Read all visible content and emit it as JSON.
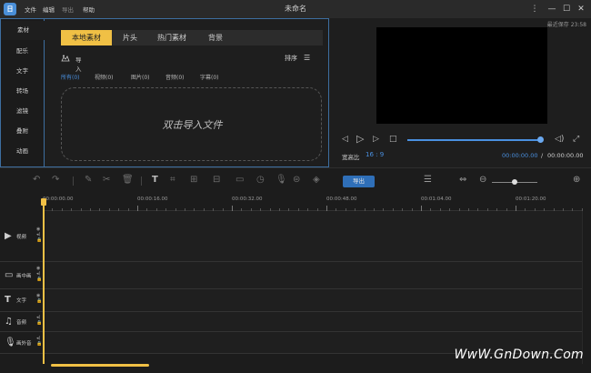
{
  "titlebar": {
    "logo": "日",
    "menu": [
      "文件",
      "编辑",
      "导出",
      "帮助"
    ],
    "title": "未命名",
    "more_icon": "⋮",
    "minimize_icon": "—",
    "maximize_icon": "☐",
    "close_icon": "✕"
  },
  "media": {
    "side_tabs": [
      "素材",
      "配乐",
      "文字",
      "转场",
      "滤镜",
      "叠附",
      "动画"
    ],
    "top_tabs": [
      "本地素材",
      "片头",
      "热门素材",
      "背景"
    ],
    "import_label": "导入",
    "sort_label": "排序",
    "filters": [
      "所有(0)",
      "视频(0)",
      "图片(0)",
      "音频(0)",
      "字幕(0)"
    ],
    "drop_text": "双击导入文件"
  },
  "preview": {
    "autosave": "最近保存 23:58",
    "aspect_label": "宽高比",
    "aspect_value": "16 : 9",
    "time_current": "00:00:00.00",
    "time_separator": "/",
    "time_total": "00:00:00.00",
    "progress": 1.0
  },
  "toolbar": {
    "export_label": "导出"
  },
  "timeline": {
    "ticks": [
      "00:00:00.00",
      "00:00:16.00",
      "00:00:32.00",
      "00:00:48.00",
      "00:01:04.00",
      "00:01:20.00"
    ],
    "tracks": [
      "视频",
      "画中画",
      "文字",
      "音频",
      "画外音"
    ]
  },
  "watermark": "WwW.GnDown.Com",
  "colors": {
    "accent": "#f0c045",
    "selection": "#4a90e0",
    "panel_border": "#3d6ea0"
  }
}
